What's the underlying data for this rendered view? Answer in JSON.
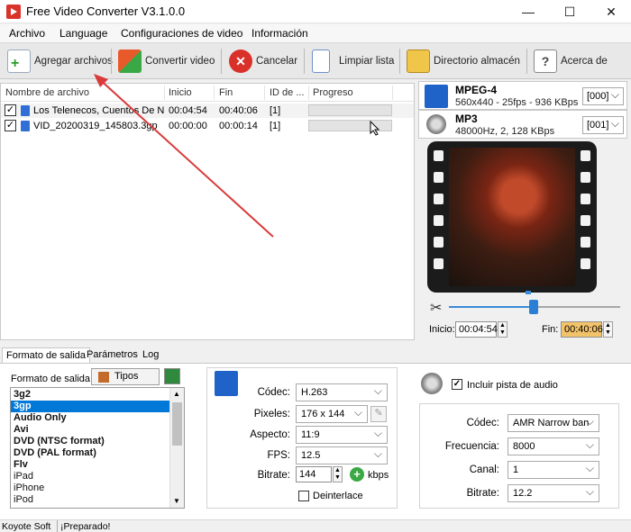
{
  "window": {
    "title": "Free Video Converter V3.1.0.0",
    "min": "—",
    "max": "☐",
    "close": "✕"
  },
  "menu": [
    "Archivo",
    "Language",
    "Configuraciones de video",
    "Información"
  ],
  "toolbar": {
    "add": "Agregar archivos",
    "convert": "Convertir video",
    "cancel": "Cancelar",
    "clear": "Limpiar lista",
    "directory": "Directorio almacén",
    "about": "Acerca de"
  },
  "filelist": {
    "headers": [
      "Nombre de archivo",
      "Inicio",
      "Fin",
      "ID de ...",
      "Progreso"
    ],
    "rows": [
      {
        "name": "Los Telenecos, Cuentos De N...",
        "start": "00:04:54",
        "end": "00:40:06",
        "id": "[1]",
        "progress": 0,
        "checked": true
      },
      {
        "name": "VID_20200319_145803.3gp",
        "start": "00:00:00",
        "end": "00:00:14",
        "id": "[1]",
        "progress": 0,
        "checked": true
      }
    ]
  },
  "output_formats": [
    {
      "title": "MPEG-4",
      "sub": "560x440 - 25fps - 936 KBps",
      "select": "[000]",
      "icon": "film-icon"
    },
    {
      "title": "MP3",
      "sub": "48000Hz, 2, 128 KBps",
      "select": "[001]",
      "icon": "speaker-icon"
    }
  ],
  "trim": {
    "start_label": "Inicio:",
    "start": "00:04:54",
    "end_label": "Fin:",
    "end": "00:40:06",
    "position": 0.5
  },
  "tabs": [
    "Formato de salida",
    "Parámetros",
    "Log"
  ],
  "format_panel": {
    "label": "Formato de salida:",
    "types_button": "Tipos",
    "items": [
      "3g2",
      "3gp",
      "Audio Only",
      "Avi",
      "DVD (NTSC format)",
      "DVD (PAL format)",
      "Flv",
      "iPad",
      "iPhone",
      "iPod"
    ],
    "selected": "3gp"
  },
  "video": {
    "codec_label": "Códec:",
    "codec": "H.263",
    "pixels_label": "Pixeles:",
    "pixels": "176 x 144",
    "aspect_label": "Aspecto:",
    "aspect": "11:9",
    "fps_label": "FPS:",
    "fps": "12.5",
    "bitrate_label": "Bitrate:",
    "bitrate": "144",
    "bitrate_unit": "kbps",
    "deinterlace": "Deinterlace"
  },
  "audio": {
    "include": "Incluir pista de audio",
    "codec_label": "Códec:",
    "codec": "AMR Narrow ban",
    "freq_label": "Frecuencia:",
    "freq": "8000",
    "channel_label": "Canal:",
    "channel": "1",
    "bitrate_label": "Bitrate:",
    "bitrate": "12.2"
  },
  "status": {
    "left": "Koyote Soft",
    "right": "¡Preparado!"
  }
}
